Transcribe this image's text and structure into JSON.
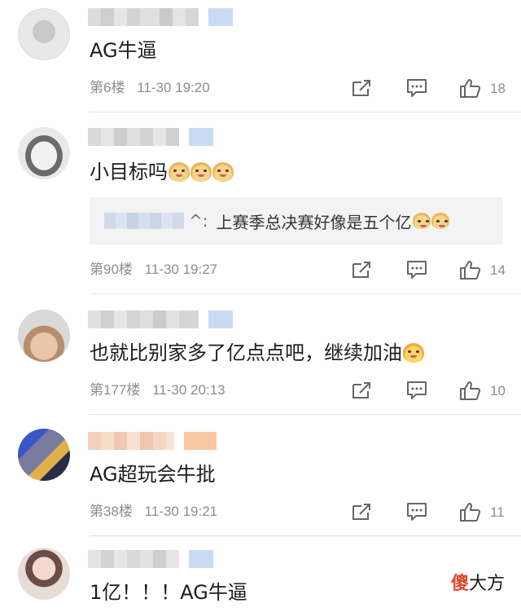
{
  "comments": [
    {
      "content": "AG牛逼",
      "floor": "第6楼",
      "time": "11-30 19:20",
      "likes": "18",
      "emoji_count": 0
    },
    {
      "content": "小目标吗",
      "floor": "第90楼",
      "time": "11-30 19:27",
      "likes": "14",
      "emoji_count": 3,
      "reply": {
        "user_suffix": "^:",
        "text": "上赛季总决赛好像是五个亿"
      }
    },
    {
      "content": "也就比别家多了亿点点吧，继续加油",
      "floor": "第177楼",
      "time": "11-30 20:13",
      "likes": "10",
      "emoji_count": 1
    },
    {
      "content": "AG超玩会牛批",
      "floor": "第38楼",
      "time": "11-30 19:21",
      "likes": "11",
      "emoji_count": 0
    },
    {
      "content": "1亿！！！AG牛逼",
      "emoji_count": 0
    }
  ],
  "icons": {
    "share": "share-icon",
    "comment": "comment-icon",
    "like": "thumbs-up-icon",
    "emoji": "doge-emoji-icon"
  },
  "watermark": {
    "part1": "傻",
    "part2": "大方"
  },
  "colors": {
    "text": "#1c1c1c",
    "meta": "#8d8d8d",
    "reply_bg": "#f3f3f3",
    "reply_user": "#5b88c6",
    "divider": "#e4e4e4",
    "watermark_accent": "#e5452a"
  }
}
